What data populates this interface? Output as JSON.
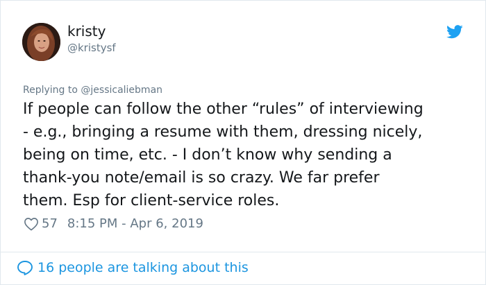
{
  "user": {
    "display_name": "kristy",
    "handle": "@kristysf"
  },
  "reply": {
    "prefix": "Replying to ",
    "mention": "@jessicaliebman"
  },
  "tweet": {
    "text": "If people can follow the other “rules” of interviewing\n- e.g., bringing a resume with them, dressing nicely,\nbeing on time, etc. - I don’t know why sending a\nthank-you note/email is so crazy. We far prefer\nthem. Esp for client-service roles."
  },
  "meta": {
    "likes": "57",
    "timestamp": "8:15 PM - Apr 6, 2019"
  },
  "footer": {
    "talking": "16 people are talking about this"
  },
  "icons": {
    "brand": "twitter-bird-icon",
    "like": "heart-icon",
    "reply": "speech-bubble-icon"
  },
  "colors": {
    "accent": "#1b95e0",
    "muted": "#657786",
    "text": "#14171a"
  }
}
